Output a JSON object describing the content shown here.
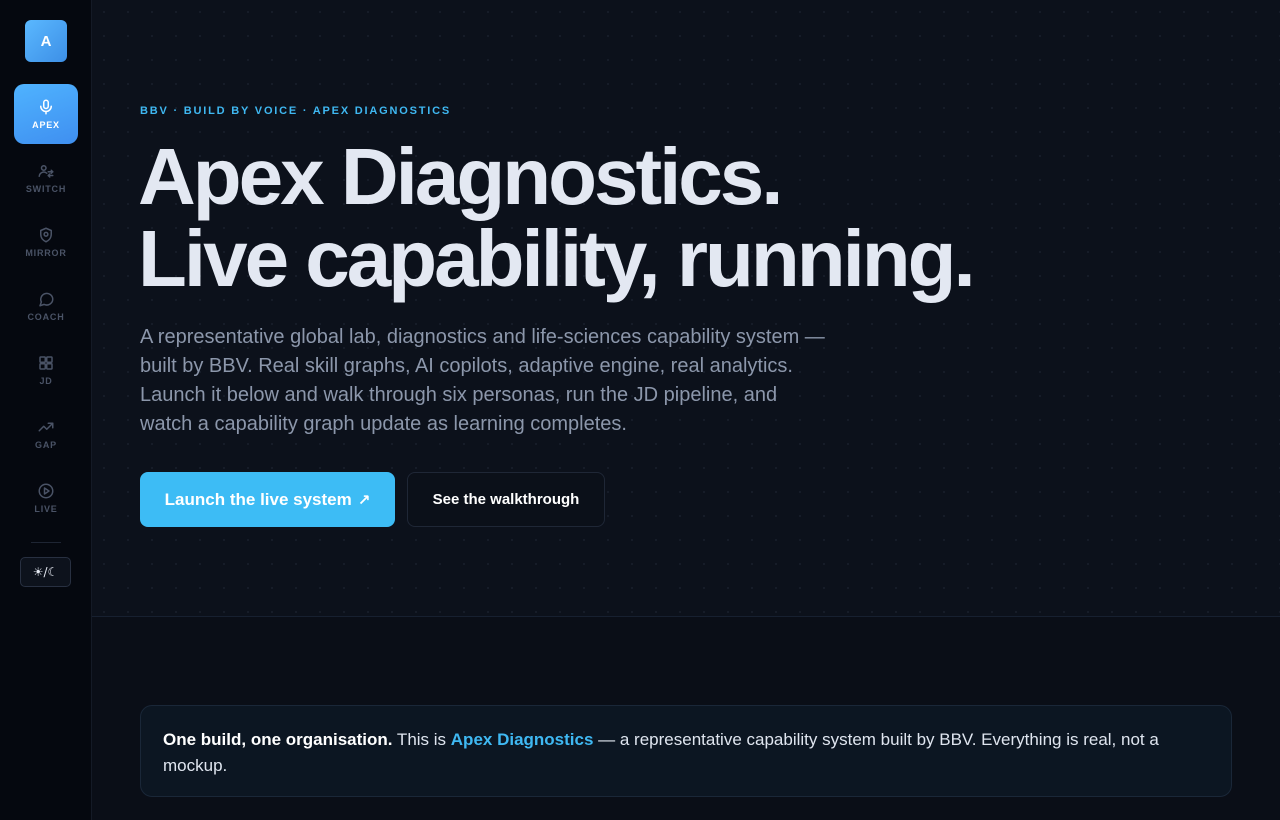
{
  "sidebar": {
    "logo": "A",
    "items": [
      {
        "label": "APEX",
        "icon": "mic-icon",
        "active": true
      },
      {
        "label": "SWITCH",
        "icon": "users-switch-icon",
        "active": false
      },
      {
        "label": "MIRROR",
        "icon": "shield-icon",
        "active": false
      },
      {
        "label": "COACH",
        "icon": "chat-bubble-icon",
        "active": false
      },
      {
        "label": "JD",
        "icon": "grid-icon",
        "active": false
      },
      {
        "label": "GAP",
        "icon": "trend-up-icon",
        "active": false
      },
      {
        "label": "LIVE",
        "icon": "play-circle-icon",
        "active": false
      }
    ],
    "theme_toggle": "☀/☾"
  },
  "hero": {
    "eyebrow": "BBV · BUILD BY VOICE · APEX DIAGNOSTICS",
    "headline_line1": "Apex Diagnostics.",
    "headline_line2": "Live capability, running.",
    "lede": "A representative global lab, diagnostics and life-sciences capability system — built by BBV. Real skill graphs, AI copilots, adaptive engine, real analytics. Launch it below and walk through six personas, run the JD pipeline, and watch a capability graph update as learning completes.",
    "primary_cta": "Launch the live system",
    "primary_cta_arrow": "↗",
    "secondary_cta": "See the walkthrough"
  },
  "callout": {
    "lead": "One build, one organisation.",
    "text_before": " This is ",
    "highlight": "Apex Diagnostics",
    "text_after": " — a representative capability system built by BBV. Everything is real, not a mockup."
  },
  "colors": {
    "accent": "#3fb8f2",
    "background": "#0a0e17",
    "sidebar_active": "#4fb3ff"
  }
}
